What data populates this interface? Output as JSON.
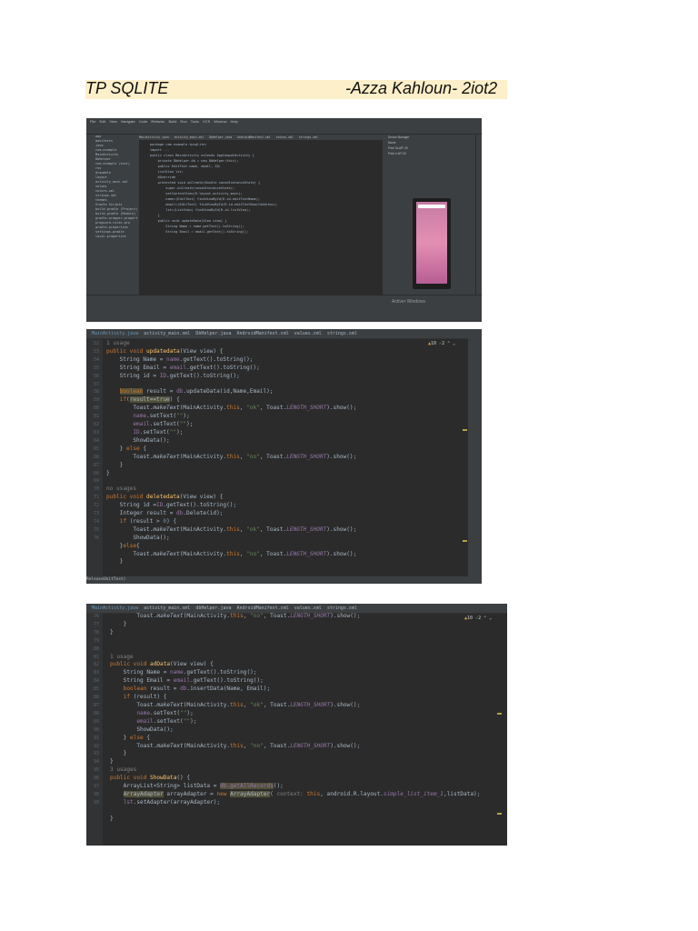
{
  "doc_header": {
    "title_left": "TP SQLITE",
    "title_right": "-Azza Kahloun- 2iot2"
  },
  "shot1": {
    "menu": [
      "File",
      "Edit",
      "View",
      "Navigate",
      "Code",
      "Refactor",
      "Build",
      "Run",
      "Tools",
      "VCS",
      "Window",
      "Help"
    ],
    "project_tree": [
      "app",
      "manifests",
      "java",
      "com.example",
      "MainActivity",
      "DbHelper",
      "com.example (test)",
      "res",
      "drawable",
      "layout",
      "activity_main.xml",
      "values",
      "colors.xml",
      "strings.xml",
      "themes",
      "Gradle Scripts",
      "build.gradle (Project)",
      "build.gradle (Module)",
      "gradle-wrapper.properties",
      "proguard-rules.pro",
      "gradle.properties",
      "settings.gradle",
      "local.properties"
    ],
    "editor_tabs": [
      "MainActivity.java",
      "activity_main.xml",
      "DbHelper.java",
      "AndroidManifest.xml",
      "values.xml",
      "strings.xml"
    ],
    "code_lines": [
      "package com.example.tpsqlite;",
      "",
      "import ...",
      "",
      "public class MainActivity extends AppCompatActivity {",
      "    private DbHelper db = new DbHelper(this);",
      "    public EditText name, email, ID;",
      "    ListView lst;",
      "",
      "    @Override",
      "    protected void onCreate(Bundle savedInstanceState) {",
      "        super.onCreate(savedInstanceState);",
      "        setContentView(R.layout.activity_main);",
      "",
      "        name=(EditText) findViewById(R.id.editTextName);",
      "        email=(EditText) findViewById(R.id.editTextEmailAddress);",
      "        lst=(ListView) findViewById(R.id.listView);",
      "    }",
      "",
      "    public void updateData(View view) {",
      "        String Name = name.getText().toString();",
      "        String Email = email.getText().toString();"
    ],
    "device_manager": [
      "Device Manager",
      "Name",
      "Pixel 3a API 30",
      "Pixel 4 API 30"
    ],
    "activate_text": "Activer Windows"
  },
  "shot2": {
    "tabs": [
      "MainActivity.java",
      "activity_main.xml",
      "DbHelper.java",
      "AndroidManifest.xml",
      "values.xml",
      "strings.xml"
    ],
    "warnings": "10",
    "checks": "2",
    "line_numbers": [
      "",
      "52",
      "53",
      "54",
      "55",
      "56",
      "57",
      "58",
      "59",
      "60",
      "61",
      "62",
      "63",
      "64",
      "65",
      "66",
      "67",
      "",
      "68",
      "69",
      "70",
      "71",
      "72",
      "73",
      "74",
      "75",
      "76",
      ""
    ],
    "status": "ReleaseUnitTest)"
  },
  "shot3": {
    "tabs": [
      "MainActivity.java",
      "activity_main.xml",
      "dbHelper.java",
      "AndroidManifest.xml",
      "values.xml",
      "strings.xml"
    ],
    "warnings": "10",
    "checks": "2",
    "line_numbers": [
      "76",
      "77",
      "78",
      "79",
      "80",
      "",
      "81",
      "82",
      "83",
      "84",
      "85",
      "86",
      "87",
      "88",
      "89",
      "90",
      "91",
      "92",
      "93",
      "",
      "94",
      "95",
      "96",
      "97",
      "98",
      "99"
    ]
  }
}
